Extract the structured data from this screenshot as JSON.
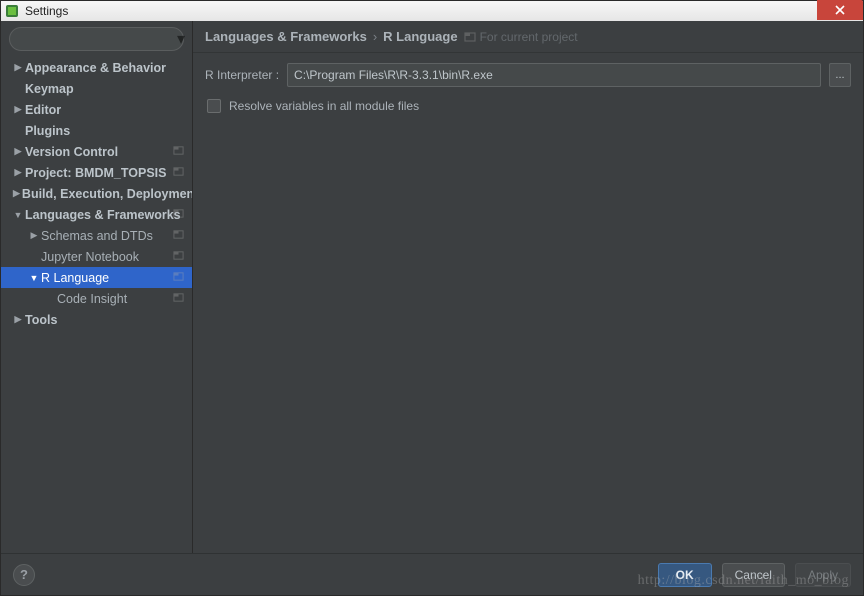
{
  "window": {
    "title": "Settings"
  },
  "sidebar": {
    "search_placeholder": "",
    "items": [
      {
        "label": "Appearance & Behavior",
        "arrow": "▶",
        "bold": true,
        "lvl": 0
      },
      {
        "label": "Keymap",
        "arrow": "",
        "bold": true,
        "lvl": 0
      },
      {
        "label": "Editor",
        "arrow": "▶",
        "bold": true,
        "lvl": 0
      },
      {
        "label": "Plugins",
        "arrow": "",
        "bold": true,
        "lvl": 0
      },
      {
        "label": "Version Control",
        "arrow": "▶",
        "bold": true,
        "lvl": 0,
        "badge": true
      },
      {
        "label": "Project: BMDM_TOPSIS",
        "arrow": "▶",
        "bold": true,
        "lvl": 0,
        "badge": true
      },
      {
        "label": "Build, Execution, Deployment",
        "arrow": "▶",
        "bold": true,
        "lvl": 0
      },
      {
        "label": "Languages & Frameworks",
        "arrow": "▼",
        "bold": true,
        "lvl": 0,
        "badge": true
      },
      {
        "label": "Schemas and DTDs",
        "arrow": "▶",
        "bold": false,
        "lvl": 1,
        "badge": true
      },
      {
        "label": "Jupyter Notebook",
        "arrow": "",
        "bold": false,
        "lvl": 1,
        "badge": true
      },
      {
        "label": "R Language",
        "arrow": "▼",
        "bold": false,
        "lvl": 1,
        "badge": true,
        "selected": true
      },
      {
        "label": "Code Insight",
        "arrow": "",
        "bold": false,
        "lvl": 2,
        "badge": true
      },
      {
        "label": "Tools",
        "arrow": "▶",
        "bold": true,
        "lvl": 0
      }
    ]
  },
  "breadcrumb": {
    "a": "Languages & Frameworks",
    "b": "R Language",
    "project_hint": "For current project"
  },
  "form": {
    "interpreter_label": "R Interpreter :",
    "interpreter_value": "C:\\Program Files\\R\\R-3.3.1\\bin\\R.exe",
    "browse_label": "...",
    "resolve_label": "Resolve variables in all module files"
  },
  "footer": {
    "ok": "OK",
    "cancel": "Cancel",
    "apply": "Apply",
    "help": "?"
  },
  "watermark": "http://blog.csdn.net/faith_mo_blog"
}
